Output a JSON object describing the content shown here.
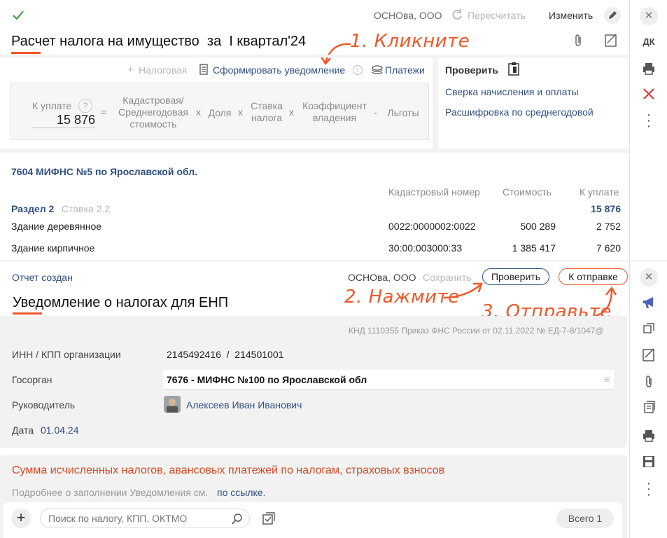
{
  "top": {
    "org": "ОСНОва, ООО",
    "recalc_label": "Пересчитать",
    "edit_label": "Изменить",
    "title": "Расчет налога на имущество  за  I квартал'24",
    "annotation1": "1. Кликните"
  },
  "toolbar": {
    "tax_label": "Налоговая",
    "form_notice_label": "Сформировать уведомление",
    "payments_label": "Платежи"
  },
  "formula": {
    "pay_label": "К уплате",
    "help": "?",
    "pay_value": "15 876",
    "eq": "=",
    "cadastral": "Кадастровая/ Среднегодовая стоимость",
    "x1": "x",
    "share": "Доля",
    "x2": "x",
    "rate": "Ставка налога",
    "x3": "x",
    "coef": "Коэффициент владения",
    "minus": "-",
    "benefits": "Льготы"
  },
  "check": {
    "title": "Проверить",
    "link1": "Сверка начисления и оплаты",
    "link2": "Расшифровка по среднегодовой"
  },
  "table": {
    "authority": "7604 МИФНС №5 по Ярославской обл.",
    "headers": [
      "Кадастровый номер",
      "Стоимость",
      "К уплате"
    ],
    "section_label": "Раздел 2",
    "section_rate": "Ставка 2.2",
    "section_total": "15 876",
    "rows": [
      {
        "name": "Здание деревянное",
        "number": "0022:0000002:0022",
        "cost": "500 289",
        "pay": "2 752"
      },
      {
        "name": "Здание кирпичное",
        "number": "30:00:003000:33",
        "cost": "1 385 417",
        "pay": "7 620"
      }
    ]
  },
  "sidebar_top": {
    "dk_label": "ДК"
  },
  "report": {
    "status": "Отчет создан",
    "org": "ОСНОва, ООО",
    "save_label": "Сохранить",
    "check_label": "Проверить",
    "send_label": "К отправке",
    "title": "Уведомление о налогах для ЕНП",
    "annotation2": "2. Нажмите",
    "annotation3": "3. Отправьте",
    "knd": "КНД 1110355 Приказ ФНС России от 02.11.2022 № ЕД-7-8/1047@",
    "inn_label": "ИНН / КПП организации",
    "inn_value": "2145492416  /  214501001",
    "authority_label": "Госорган",
    "authority_value": "7676 - МИФНС №100 по Ярославской обл",
    "head_label": "Руководитель",
    "head_value": "Алексеев Иван Иванович",
    "date_label": "Дата",
    "date_value": "01.04.24",
    "sum_title": "Сумма исчисленных налогов, авансовых платежей по налогам, страховых взносов",
    "hint_text": "Подробнее о заполнении Уведомления см.",
    "hint_link": "по ссылке.",
    "search_placeholder": "Поиск по налогу, КПП, ОКТМО",
    "total_label": "Всего 1"
  },
  "colors": {
    "accent": "#f0572a",
    "link": "#2f4f82",
    "panel": "#f2f2f2"
  }
}
